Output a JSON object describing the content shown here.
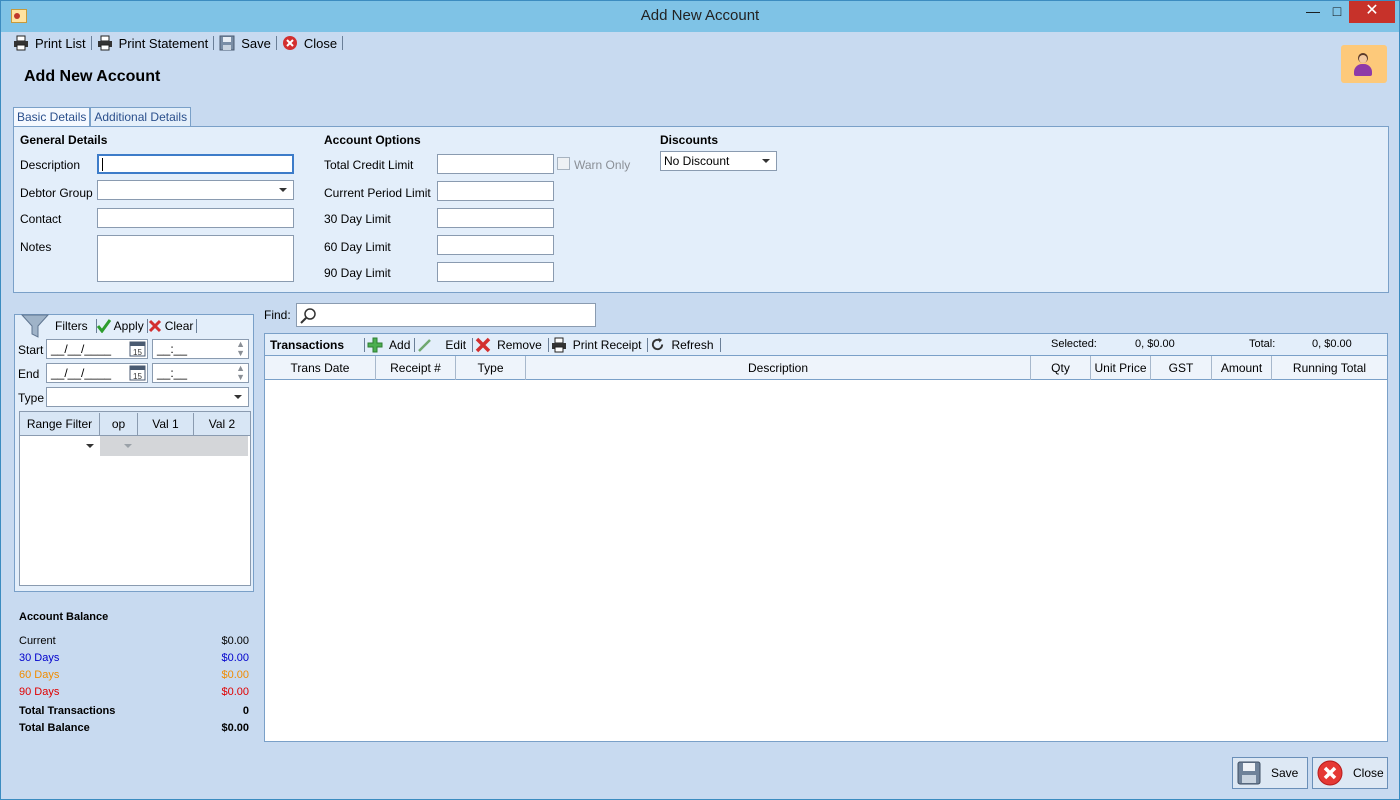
{
  "window": {
    "title": "Add New Account"
  },
  "toolbar": {
    "print_list": "Print List",
    "print_statement": "Print Statement",
    "save": "Save",
    "close": "Close"
  },
  "page": {
    "title": "Add New Account"
  },
  "tabs": [
    "Basic Details",
    "Additional Details"
  ],
  "general": {
    "title": "General Details",
    "description_label": "Description",
    "debtor_group_label": "Debtor Group",
    "contact_label": "Contact",
    "notes_label": "Notes"
  },
  "account_options": {
    "title": "Account Options",
    "total_credit_limit": "Total Credit Limit",
    "warn_only": "Warn Only",
    "current_period_limit": "Current Period Limit",
    "day30_limit": "30 Day Limit",
    "day60_limit": "60 Day Limit",
    "day90_limit": "90 Day Limit"
  },
  "discounts": {
    "title": "Discounts",
    "selected": "No Discount"
  },
  "filters": {
    "label": "Filters",
    "apply": "Apply",
    "clear": "Clear",
    "start_label": "Start",
    "end_label": "End",
    "type_label": "Type",
    "date_placeholder": "__/__/____",
    "time_placeholder": "__:__",
    "range_headers": [
      "Range Filter",
      "op",
      "Val 1",
      "Val 2"
    ]
  },
  "balance": {
    "title": "Account Balance",
    "rows": [
      {
        "label": "Current",
        "value": "$0.00",
        "color": "#000000"
      },
      {
        "label": "30 Days",
        "value": "$0.00",
        "color": "#0000cc"
      },
      {
        "label": "60 Days",
        "value": "$0.00",
        "color": "#f08c00"
      },
      {
        "label": "90 Days",
        "value": "$0.00",
        "color": "#e00000"
      }
    ],
    "total_transactions_label": "Total Transactions",
    "total_transactions_value": "0",
    "total_balance_label": "Total Balance",
    "total_balance_value": "$0.00"
  },
  "find": {
    "label": "Find:"
  },
  "transactions": {
    "title": "Transactions",
    "add": "Add",
    "edit": "Edit",
    "remove": "Remove",
    "print_receipt": "Print Receipt",
    "refresh": "Refresh",
    "selected_label": "Selected:",
    "selected_value": "0, $0.00",
    "total_label": "Total:",
    "total_value": "0, $0.00",
    "columns": [
      "Trans Date",
      "Receipt #",
      "Type",
      "Description",
      "Qty",
      "Unit Price",
      "GST",
      "Amount",
      "Running Total"
    ]
  },
  "bottom": {
    "save": "Save",
    "close": "Close"
  }
}
